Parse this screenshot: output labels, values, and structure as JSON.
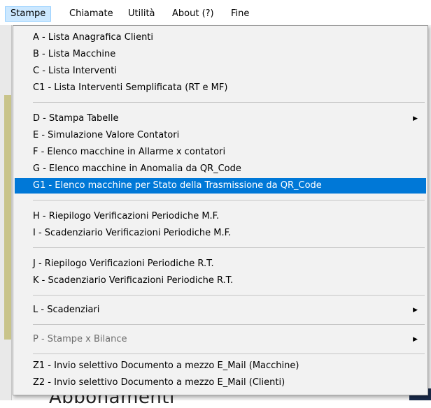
{
  "menubar": {
    "items": [
      "Stampe",
      "Chiamate",
      "Utilità",
      "About (?)",
      "Fine"
    ]
  },
  "background": {
    "partial_text": "Abbonamenti"
  },
  "dropdown": {
    "items": [
      "A - Lista Anagrafica Clienti",
      "B - Lista Macchine",
      "C - Lista Interventi",
      "C1 - Lista Interventi Semplificata (RT e MF)",
      "D - Stampa Tabelle",
      "E - Simulazione Valore Contatori",
      "F - Elenco macchine in Allarme x contatori",
      "G - Elenco macchine in Anomalia da QR_Code",
      "G1 - Elenco macchine per Stato della Trasmissione da QR_Code",
      "H - Riepilogo Verificazioni Periodiche M.F.",
      "I - Scadenziario Verificazioni Periodiche M.F.",
      "J - Riepilogo Verificazioni Periodiche R.T.",
      "K - Scadenziario Verificazioni Periodiche R.T.",
      "L - Scadenziari",
      "P - Stampe x Bilance",
      "Z1 - Invio selettivo Documento a mezzo E_Mail (Macchine)",
      "Z2 - Invio selettivo Documento a mezzo E_Mail (Clienti)"
    ],
    "submenu_arrow": "▶"
  },
  "colors": {
    "highlight": "#0078d7",
    "menubar_active": "#cce8ff",
    "disabled_text": "#6d6d6d"
  }
}
